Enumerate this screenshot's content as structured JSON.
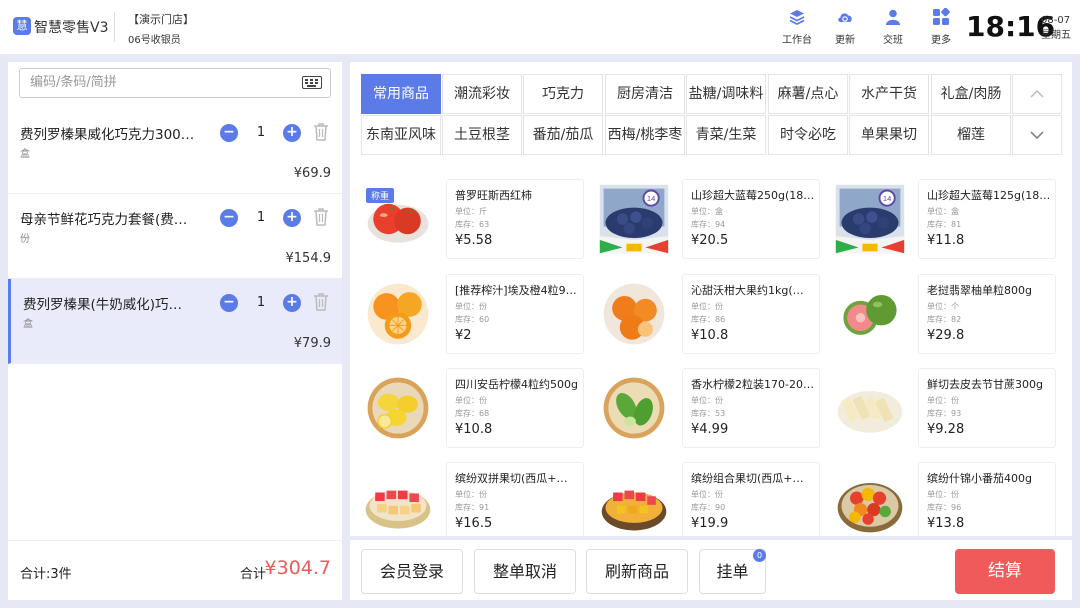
{
  "header": {
    "app_title": "智慧零售V3",
    "store": "【演示门店】",
    "cashier": "06号收银员",
    "tools": [
      {
        "label": "工作台",
        "icon": "stack-icon"
      },
      {
        "label": "更新",
        "icon": "cloud-sync-icon"
      },
      {
        "label": "交班",
        "icon": "user-icon"
      },
      {
        "label": "更多",
        "icon": "grid-icon"
      }
    ],
    "time": "18:16",
    "date": "08-07",
    "weekday": "星期五"
  },
  "search": {
    "placeholder": "编码/条码/简拼"
  },
  "cart": {
    "items": [
      {
        "name": "费列罗榛果威化巧克力300…",
        "unit": "盒",
        "qty": "1",
        "price": "¥69.9"
      },
      {
        "name": "母亲节鲜花巧克力套餐(费…",
        "unit": "份",
        "qty": "1",
        "price": "¥154.9"
      },
      {
        "name": "费列罗榛果(牛奶威化)巧…",
        "unit": "盒",
        "qty": "1",
        "price": "¥79.9"
      }
    ],
    "count_label": "合计:3件",
    "total_label": "合计",
    "total_value": "¥304.7"
  },
  "categories": {
    "row1": [
      "常用商品",
      "潮流彩妆",
      "巧克力",
      "厨房清洁",
      "盐糖/调味料",
      "麻薯/点心",
      "水产干货",
      "礼盒/肉肠"
    ],
    "row2": [
      "东南亚风味",
      "土豆根茎",
      "番茄/茄瓜",
      "西梅/桃李枣",
      "青菜/生菜",
      "时令必吃",
      "单果果切",
      "榴莲"
    ],
    "active": "常用商品"
  },
  "product_labels": {
    "unit_prefix": "单位：",
    "stock_prefix": "库存："
  },
  "products": [
    {
      "name": "普罗旺斯西红柿",
      "unit": "斤",
      "stock": "63",
      "price": "¥5.58",
      "tag": "称重",
      "image": "tomato"
    },
    {
      "name": "山珍超大蓝莓250g(18…",
      "unit": "盒",
      "stock": "94",
      "price": "¥20.5",
      "image": "blueberry",
      "box_badge": "14"
    },
    {
      "name": "山珍超大蓝莓125g(18…",
      "unit": "盒",
      "stock": "81",
      "price": "¥11.8",
      "image": "blueberry",
      "box_badge": "14"
    },
    {
      "name": "[推荐榨汁]埃及橙4粒9…",
      "unit": "份",
      "stock": "60",
      "price": "¥2",
      "image": "orange"
    },
    {
      "name": "沁甜沃柑大果约1kg(…",
      "unit": "份",
      "stock": "86",
      "price": "¥10.8",
      "image": "tangerine"
    },
    {
      "name": "老挝翡翠柚单粒800g",
      "unit": "个",
      "stock": "82",
      "price": "¥29.8",
      "image": "pomelo"
    },
    {
      "name": "四川安岳柠檬4粒约500g",
      "unit": "份",
      "stock": "68",
      "price": "¥10.8",
      "image": "lemon"
    },
    {
      "name": "香水柠檬2粒装170-20…",
      "unit": "份",
      "stock": "53",
      "price": "¥4.99",
      "image": "lime"
    },
    {
      "name": "鲜切去皮去节甘蔗300g",
      "unit": "份",
      "stock": "93",
      "price": "¥9.28",
      "image": "sugarcane"
    },
    {
      "name": "缤纷双拼果切(西瓜+…",
      "unit": "份",
      "stock": "91",
      "price": "¥16.5",
      "image": "fruitcut1"
    },
    {
      "name": "缤纷组合果切(西瓜+…",
      "unit": "份",
      "stock": "90",
      "price": "¥19.9",
      "image": "fruitcut2"
    },
    {
      "name": "缤纷什锦小番茄400g",
      "unit": "份",
      "stock": "96",
      "price": "¥13.8",
      "image": "cherrytomato"
    }
  ],
  "actions": {
    "member_login": "会员登录",
    "cancel_order": "整单取消",
    "refresh": "刷新商品",
    "hang": "挂单",
    "hang_badge": "0",
    "checkout": "结算"
  },
  "colors": {
    "accent": "#5b7be8",
    "danger": "#f05a5a",
    "selected_row": "#e9ebfb"
  }
}
